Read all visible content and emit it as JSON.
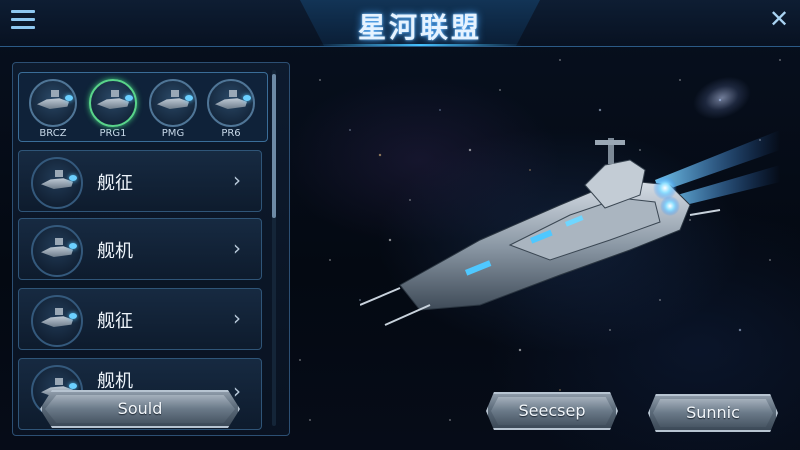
{
  "header": {
    "title": "星河联盟"
  },
  "ship_selector": [
    {
      "label": "BRCZ"
    },
    {
      "label": "PRG1"
    },
    {
      "label": "PMG"
    },
    {
      "label": "PR6"
    }
  ],
  "ship_list": [
    {
      "name": "舰征"
    },
    {
      "name": "舰机"
    },
    {
      "name": "舰征"
    },
    {
      "name": "舰机"
    }
  ],
  "buttons": {
    "sould": "Sould",
    "seecsep": "Seecsep",
    "sunnic": "Sunnic"
  },
  "colors": {
    "accent": "#46c3ff",
    "selected_ring": "#59d48a",
    "panel_border": "#2c4f73"
  }
}
